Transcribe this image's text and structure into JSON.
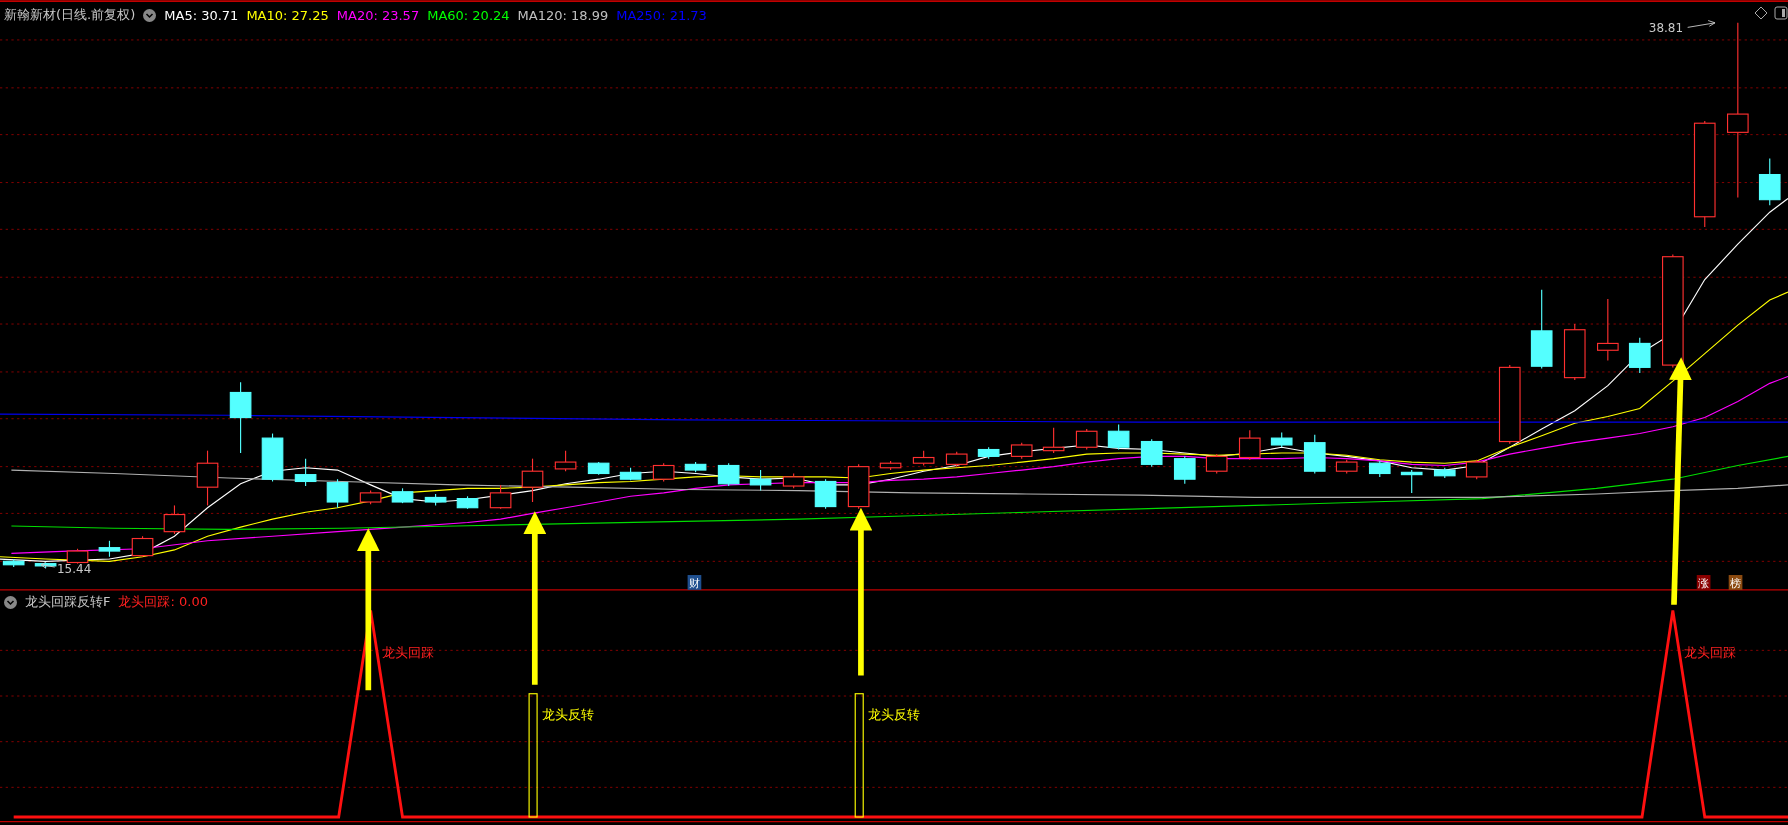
{
  "header": {
    "title": "新翰新材(日线.前复权)",
    "moving_averages": [
      {
        "label": "MA5: 30.71",
        "color": "#ffffff"
      },
      {
        "label": "MA10: 27.25",
        "color": "#ffff00"
      },
      {
        "label": "MA20: 23.57",
        "color": "#ff00ff"
      },
      {
        "label": "MA60: 20.24",
        "color": "#00ff00"
      },
      {
        "label": "MA120: 18.99",
        "color": "#c0c0c0"
      },
      {
        "label": "MA250: 21.73",
        "color": "#0000ff"
      }
    ]
  },
  "main_chart": {
    "high_label": "38.81",
    "low_label": "15.44",
    "markers": [
      {
        "text": "财",
        "color": "#1f4f8f"
      },
      {
        "text": "涨",
        "color": "#8b0000"
      },
      {
        "text": "榜",
        "color": "#8b4a10"
      }
    ]
  },
  "indicator_panel": {
    "title": "龙头回踩反转F",
    "readout": "龙头回踩: 0.00",
    "signals": [
      {
        "kind": "pullback",
        "label": "龙头回踩"
      },
      {
        "kind": "reversal",
        "label": "龙头反转"
      },
      {
        "kind": "reversal",
        "label": "龙头反转"
      },
      {
        "kind": "pullback",
        "label": "龙头回踩"
      }
    ]
  }
}
